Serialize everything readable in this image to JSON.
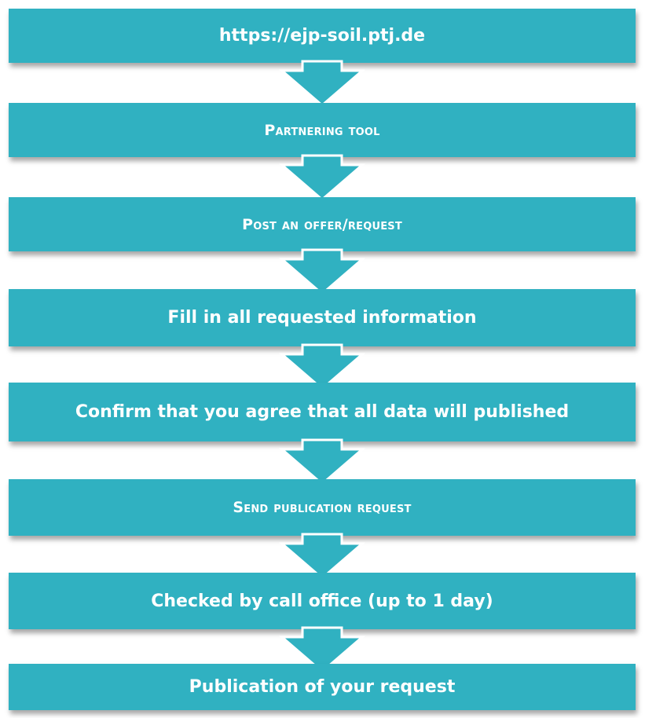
{
  "flow": {
    "steps": [
      {
        "label": "https://ejp-soil.ptj.de",
        "style": "big"
      },
      {
        "label": "Partnering tool",
        "style": "sc"
      },
      {
        "label": "Post an offer/request",
        "style": "sc"
      },
      {
        "label": "Fill in all requested information",
        "style": "big"
      },
      {
        "label": "Confirm that you agree that all data will published",
        "style": "big"
      },
      {
        "label": "Send publication request",
        "style": "sc"
      },
      {
        "label": "Checked by call office (up to 1 day)",
        "style": "big"
      },
      {
        "label": "Publication of your request",
        "style": "big"
      }
    ],
    "colors": {
      "box": "#30b1c1",
      "text": "#ffffff",
      "arrow": "#30b1c1",
      "arrow_outline": "#ffffff"
    },
    "connector_icon": "chevron-down-arrow-icon"
  }
}
